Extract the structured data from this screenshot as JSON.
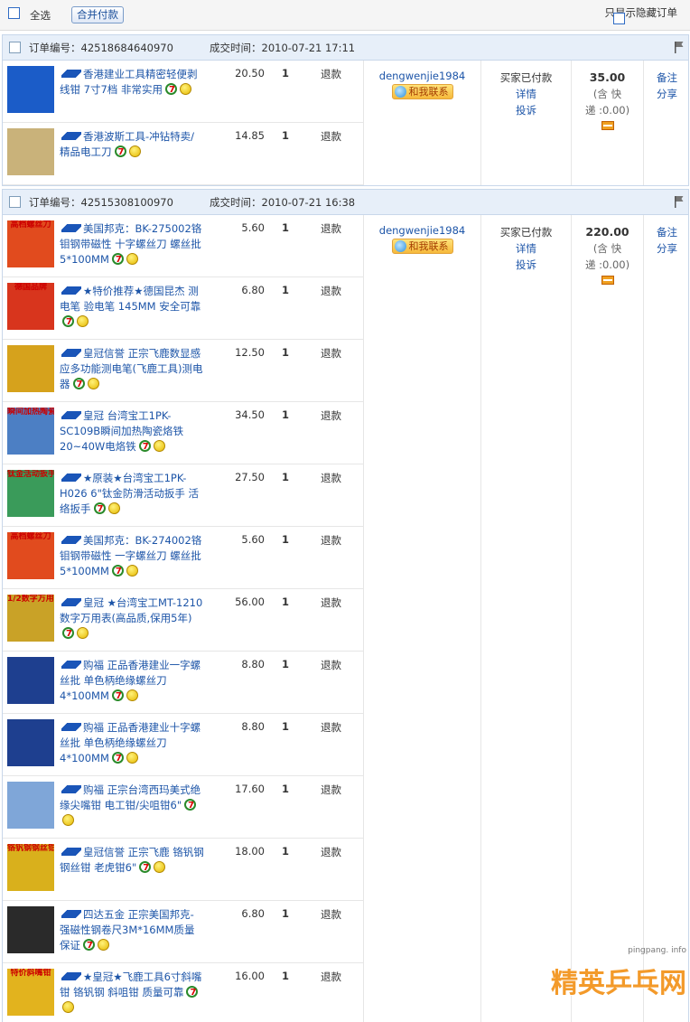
{
  "toolbar": {
    "select_all_label": "全选",
    "merge_pay_label": "合并付款",
    "show_hidden_label": "只显示隐藏订单"
  },
  "orders": [
    {
      "order_no": "订单编号：42518684640970",
      "time": "成交时间：2010-07-21 17:11",
      "seller": "dengwenjie1984",
      "contact_label": "和我联系",
      "status": "买家已付款",
      "detail_label": "详情",
      "complain_label": "投诉",
      "total": "35.00",
      "shipping_line1": "(含 快",
      "shipping_line2": "递 :0.00)",
      "memo_label": "备注",
      "share_label": "分享",
      "items": [
        {
          "pre": "",
          "mid": "皇冠",
          "title": "香港建业工具精密轻便剥线钳 7寸7档 非常实用",
          "price": "20.50",
          "qty": "1",
          "refund": "退款",
          "thumb_text": "",
          "thumb_color": "#1b5cc8"
        },
        {
          "pre": "",
          "mid": "",
          "title": "香港波斯工具-冲钻特卖/精品电工刀",
          "price": "14.85",
          "qty": "1",
          "refund": "退款",
          "thumb_text": "",
          "thumb_color": "#c9b27a"
        }
      ]
    },
    {
      "order_no": "订单编号：42515308100970",
      "time": "成交时间：2010-07-21 16:38",
      "seller": "dengwenjie1984",
      "contact_label": "和我联系",
      "status": "买家已付款",
      "detail_label": "详情",
      "complain_label": "投诉",
      "total": "220.00",
      "shipping_line1": "(含 快",
      "shipping_line2": "递 :0.00)",
      "memo_label": "备注",
      "share_label": "分享",
      "items": [
        {
          "title": "美国邦克：BK-275002铬钼钢带磁性 十字螺丝刀 螺丝批5*100MM",
          "price": "5.60",
          "qty": "1",
          "refund": "退款",
          "thumb_text": "高档螺丝刀",
          "thumb_color": "#e14b1e"
        },
        {
          "title": "★特价推荐★德国昆杰 测电笔 验电笔 145MM 安全可靠",
          "price": "6.80",
          "qty": "1",
          "refund": "退款",
          "thumb_text": "德国品牌",
          "thumb_color": "#d8351d"
        },
        {
          "title": "皇冠信誉 正宗飞鹿数显感应多功能测电笔(飞鹿工具)测电器",
          "price": "12.50",
          "qty": "1",
          "refund": "退款",
          "thumb_text": "",
          "thumb_color": "#d6a21c"
        },
        {
          "title": "皇冠 台湾宝工1PK-SC109B瞬间加热陶瓷烙铁20~40W电烙铁",
          "price": "34.50",
          "qty": "1",
          "refund": "退款",
          "thumb_text": "瞬间加热陶瓷",
          "thumb_color": "#4c7fc4"
        },
        {
          "title": "★原装★台湾宝工1PK-H026 6\"钛金防滑活动扳手 活络扳手",
          "price": "27.50",
          "qty": "1",
          "refund": "退款",
          "thumb_text": "钛金活动扳手",
          "thumb_color": "#3a9b5a"
        },
        {
          "title": "美国邦克：BK-274002铬钼钢带磁性 一字螺丝刀 螺丝批5*100MM",
          "price": "5.60",
          "qty": "1",
          "refund": "退款",
          "thumb_text": "高档螺丝刀",
          "thumb_color": "#e14b1e"
        },
        {
          "title": "皇冠 ★台湾宝工MT-1210数字万用表(高品质,保用5年)",
          "price": "56.00",
          "qty": "1",
          "refund": "退款",
          "thumb_text": "1/2数字万用表",
          "thumb_color": "#c9a227"
        },
        {
          "title": "购福 正品香港建业一字螺丝批 单色柄绝缘螺丝刀4*100MM",
          "price": "8.80",
          "qty": "1",
          "refund": "退款",
          "thumb_text": "",
          "thumb_color": "#1e3f8f"
        },
        {
          "title": "购福 正品香港建业十字螺丝批 单色柄绝缘螺丝刀4*100MM",
          "price": "8.80",
          "qty": "1",
          "refund": "退款",
          "thumb_text": "",
          "thumb_color": "#1e3f8f"
        },
        {
          "title": "购福 正宗台湾西玛美式绝缘尖嘴钳 电工钳/尖咀钳6\"",
          "price": "17.60",
          "qty": "1",
          "refund": "退款",
          "thumb_text": "",
          "thumb_color": "#7fa6d8"
        },
        {
          "title": "皇冠信誉 正宗飞鹿 铬钒钢 钢丝钳 老虎钳6\"",
          "price": "18.00",
          "qty": "1",
          "refund": "退款",
          "thumb_text": "铬钒钢钢丝钳",
          "thumb_color": "#d9b01c"
        },
        {
          "title": "四达五金 正宗美国邦克-强磁性钢卷尺3M*16MM质量保证",
          "price": "6.80",
          "qty": "1",
          "refund": "退款",
          "thumb_text": "",
          "thumb_color": "#2a2a2a"
        },
        {
          "title": "★皇冠★飞鹿工具6寸斜嘴钳 铬钒钢 斜咀钳 质量可靠",
          "price": "16.00",
          "qty": "1",
          "refund": "退款",
          "thumb_text": "特价斜嘴钳",
          "thumb_color": "#e2b31e"
        }
      ]
    }
  ],
  "watermark": {
    "site": "pingpang. info",
    "brand": "精英乒乓网"
  }
}
